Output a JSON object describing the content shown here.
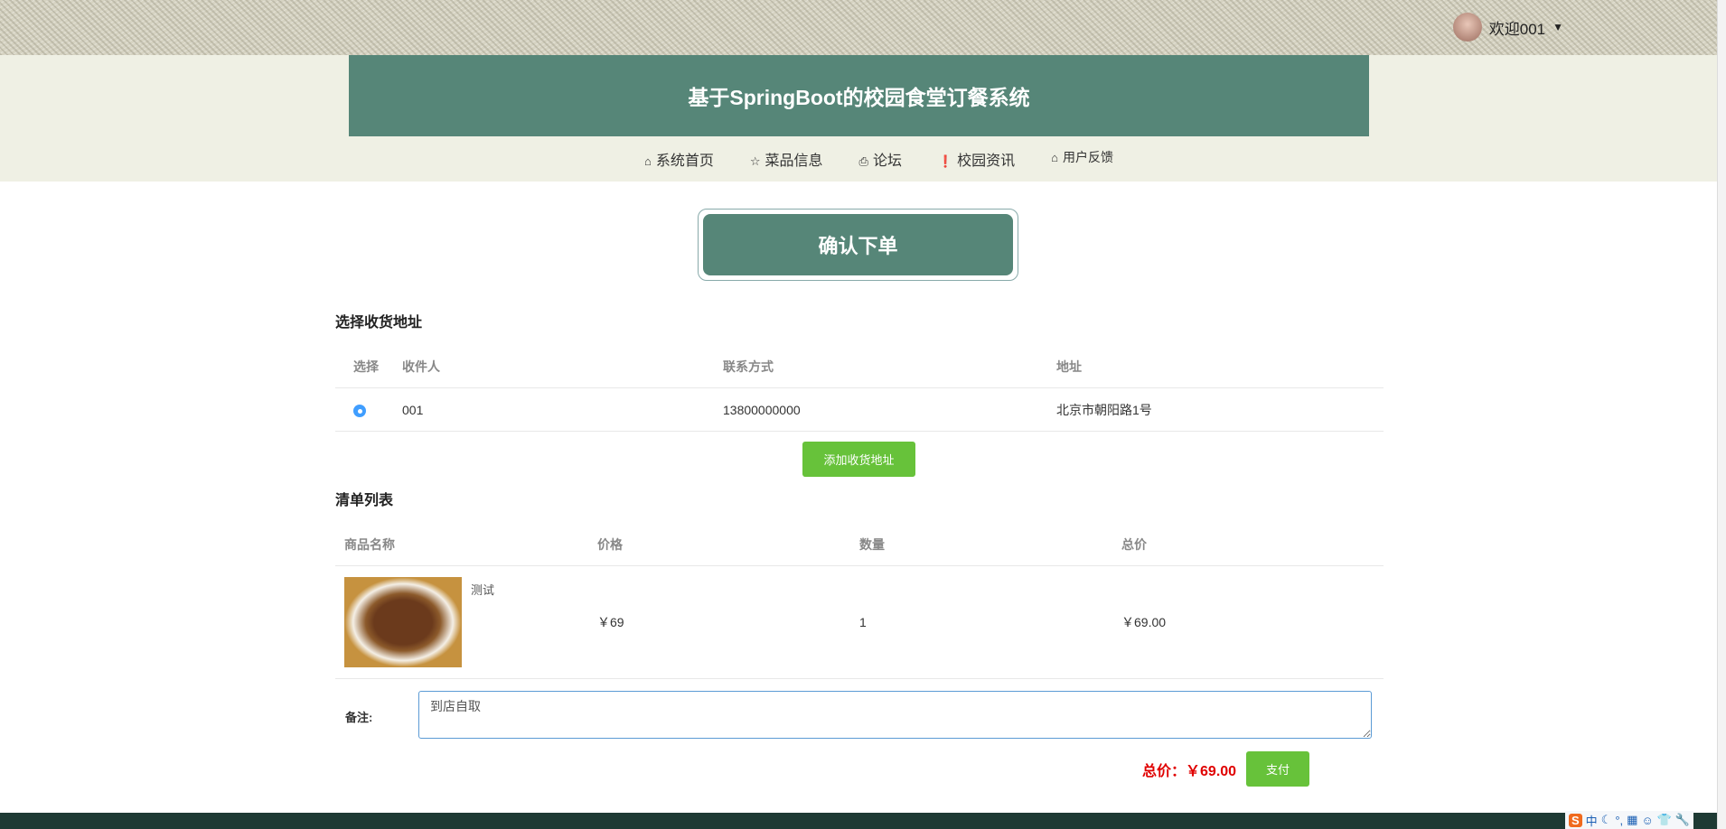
{
  "header": {
    "user_greeting": "欢迎001",
    "title": "基于SpringBoot的校园食堂订餐系统"
  },
  "nav": [
    {
      "label": "系统首页",
      "icon": "home-icon"
    },
    {
      "label": "菜品信息",
      "icon": "star-icon"
    },
    {
      "label": "论坛",
      "icon": "bag-icon"
    },
    {
      "label": "校园资讯",
      "icon": "info-icon"
    },
    {
      "label": "用户反馈",
      "icon": "home-icon"
    }
  ],
  "page_title": "确认下单",
  "address": {
    "heading": "选择收货地址",
    "columns": [
      "选择",
      "收件人",
      "联系方式",
      "地址"
    ],
    "rows": [
      {
        "selected": true,
        "name": "001",
        "phone": "13800000000",
        "address": "北京市朝阳路1号"
      }
    ],
    "add_button": "添加收货地址"
  },
  "cart": {
    "heading": "清单列表",
    "columns": [
      "商品名称",
      "价格",
      "数量",
      "总价"
    ],
    "rows": [
      {
        "name": "测试",
        "price": "￥69",
        "qty": "1",
        "total": "￥69.00"
      }
    ]
  },
  "remark": {
    "label": "备注:",
    "value": "到店自取"
  },
  "total": {
    "label": "总价：",
    "value": "￥69.00",
    "color": "#e00000"
  },
  "pay_button": "支付",
  "ime": {
    "logo": "S",
    "mode": "中"
  }
}
